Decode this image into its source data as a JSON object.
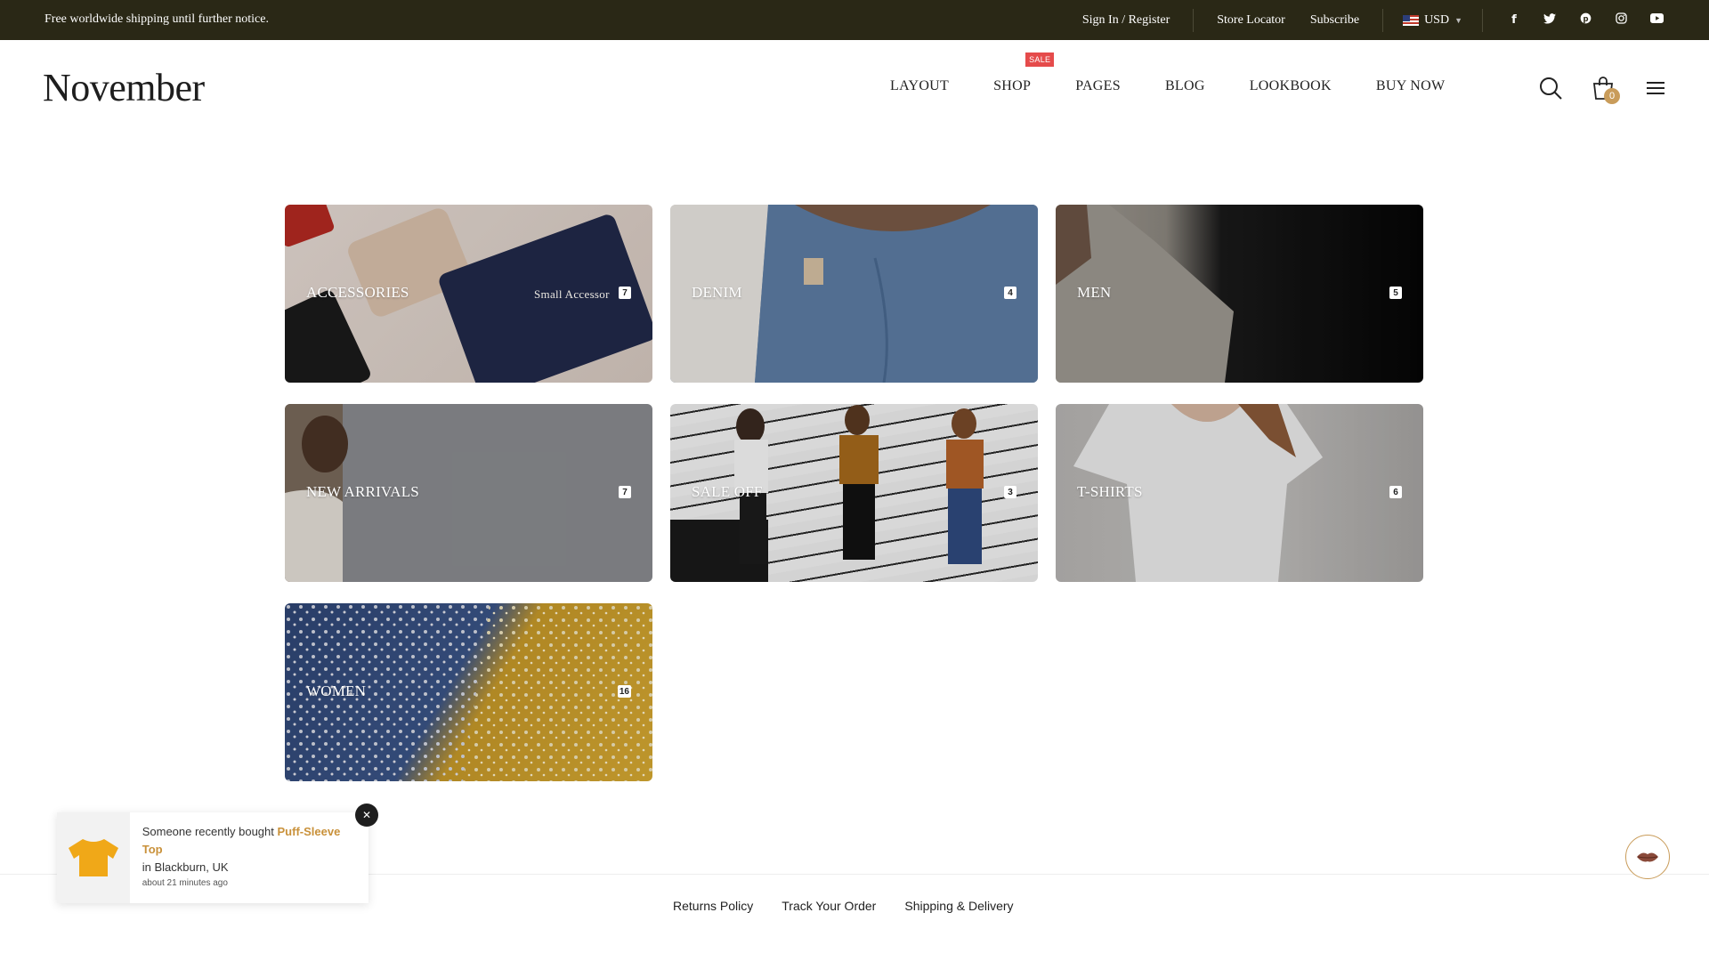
{
  "topbar": {
    "promo": "Free worldwide shipping until further notice.",
    "sign_in": "Sign In / Register",
    "store_locator": "Store Locator",
    "subscribe": "Subscribe",
    "currency": "USD",
    "social_icons": [
      "facebook-icon",
      "twitter-icon",
      "pinterest-icon",
      "instagram-icon",
      "youtube-icon"
    ]
  },
  "header": {
    "logo": "November",
    "nav": [
      {
        "label": "LAYOUT"
      },
      {
        "label": "SHOP",
        "badge": "SALE"
      },
      {
        "label": "PAGES"
      },
      {
        "label": "BLOG"
      },
      {
        "label": "LOOKBOOK"
      },
      {
        "label": "BUY NOW"
      }
    ],
    "cart_count": "0"
  },
  "categories": [
    {
      "label": "ACCESSORIES",
      "count": "7",
      "sub": "Small Accessor"
    },
    {
      "label": "DENIM",
      "count": "4"
    },
    {
      "label": "MEN",
      "count": "5"
    },
    {
      "label": "NEW ARRIVALS",
      "count": "7"
    },
    {
      "label": "SALE OFF",
      "count": "3"
    },
    {
      "label": "T-SHIRTS",
      "count": "6"
    },
    {
      "label": "WOMEN",
      "count": "16"
    }
  ],
  "footer": {
    "links": [
      "Returns Policy",
      "Track Your Order",
      "Shipping & Delivery"
    ]
  },
  "toast": {
    "prefix": "Someone recently bought",
    "product": "Puff-Sleeve Top",
    "location": "in Blackburn, UK",
    "time": "about 21 minutes ago"
  },
  "colors": {
    "topbar_bg": "#2a2816",
    "accent": "#c99c5a",
    "sale_badge": "#e54b4b"
  }
}
